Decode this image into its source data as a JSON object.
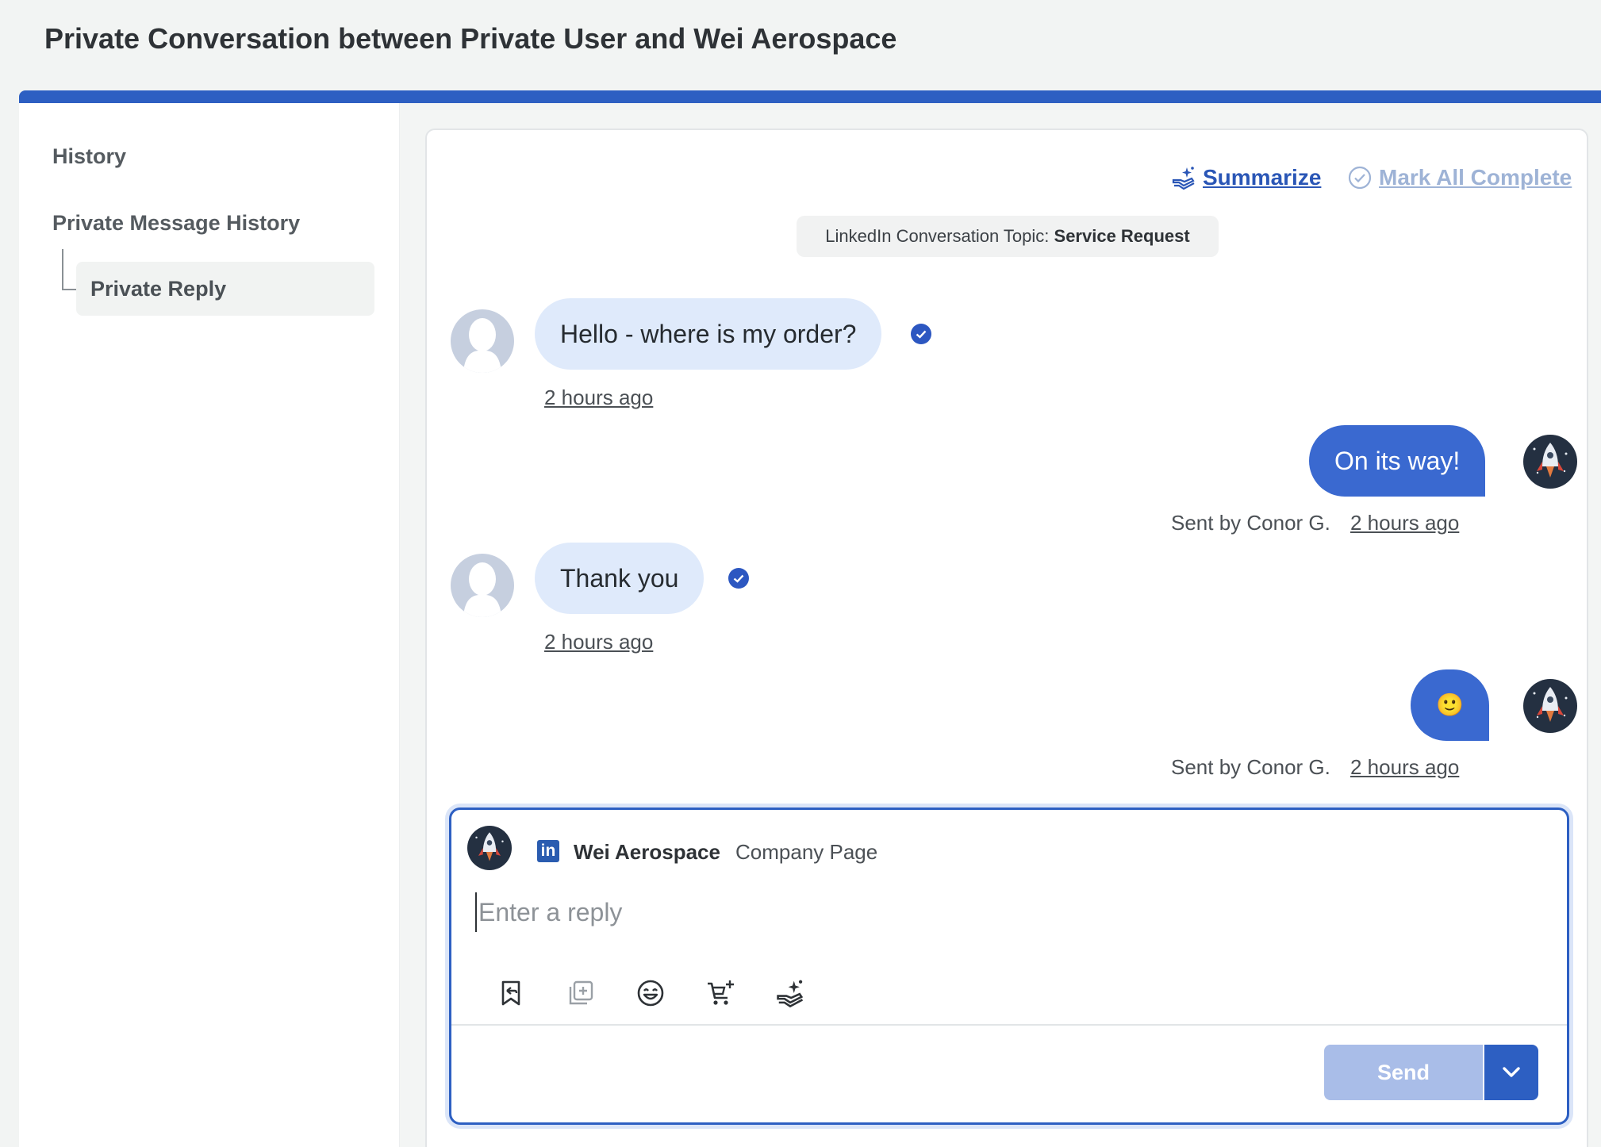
{
  "page": {
    "title": "Private Conversation between Private User and Wei Aerospace"
  },
  "sidebar": {
    "history_label": "History",
    "pm_history_label": "Private Message History",
    "private_reply_label": "Private Reply"
  },
  "toolbar": {
    "summarize_label": "Summarize",
    "mark_all_label": "Mark All Complete"
  },
  "topic": {
    "prefix": "LinkedIn Conversation Topic:",
    "value": "Service Request"
  },
  "messages": [
    {
      "direction": "in",
      "text": "Hello - where is my order?",
      "time": "2 hours ago"
    },
    {
      "direction": "out",
      "text": "On its way!",
      "sender": "Sent by Conor G.",
      "time": "2 hours ago"
    },
    {
      "direction": "in",
      "text": "Thank you",
      "time": "2 hours ago"
    },
    {
      "direction": "out",
      "text": "🙂",
      "sender": "Sent by Conor G.",
      "time": "2 hours ago"
    }
  ],
  "composer": {
    "network_icon": "linkedin-icon",
    "network_badge": "in",
    "page_name": "Wei Aerospace",
    "page_type": "Company Page",
    "placeholder": "Enter a reply",
    "tools": [
      "saved-reply-icon",
      "add-media-icon",
      "emoji-icon",
      "add-product-icon",
      "ai-assist-icon"
    ],
    "send_label": "Send"
  },
  "colors": {
    "accent": "#2d5fc2",
    "incoming_bubble": "#dfeafb",
    "outgoing_bubble": "#3a69d0",
    "send_disabled": "#a9bde8"
  }
}
